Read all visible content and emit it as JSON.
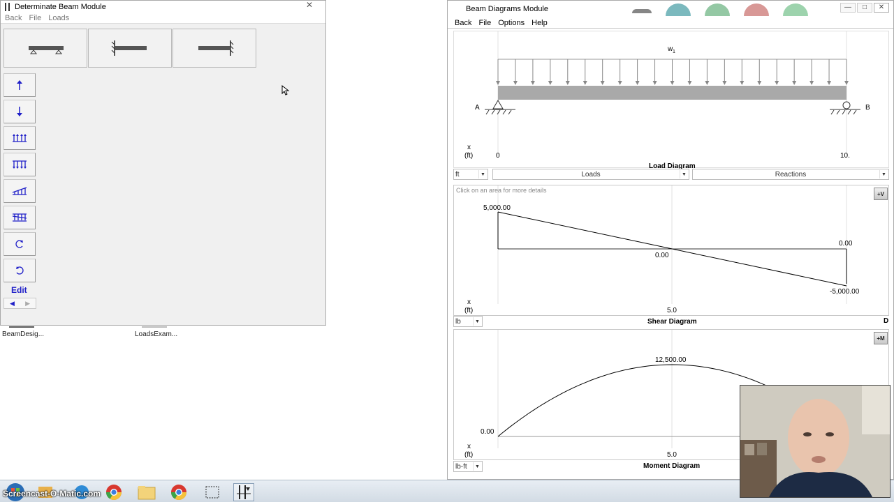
{
  "desktop": {
    "icons": [
      {
        "label": "BeamDesig..."
      },
      {
        "label": "LoadsExam..."
      }
    ]
  },
  "left_window": {
    "title": "Determinate Beam Module",
    "menu": [
      "Back",
      "File",
      "Loads"
    ],
    "support_buttons": [
      "simply-supported",
      "cantilever-left",
      "cantilever-right"
    ],
    "tools": [
      "point-load-up",
      "point-load-down",
      "uniform-load-up",
      "uniform-load-down",
      "varying-load-up",
      "varying-load-down",
      "moment-ccw",
      "moment-cw"
    ],
    "edit_label": "Edit"
  },
  "right_window": {
    "title": "Beam Diagrams Module",
    "menu": [
      "Back",
      "File",
      "Options",
      "Help"
    ],
    "load_diagram": {
      "load_label": "w",
      "load_subscript": "1",
      "support_a": "A",
      "support_b": "B",
      "x_label": "x",
      "x_unit": "(ft)",
      "x_start": "0",
      "x_end": "10.",
      "caption": "Load Diagram",
      "unit_select": "ft",
      "loads_select": "Loads",
      "reactions_select": "Reactions"
    },
    "shear_diagram": {
      "hint": "Click on an area for more details",
      "corner": "+V",
      "max_label": "5,000.00",
      "mid_label": "0.00",
      "end_label": "0.00",
      "min_label": "-5,000.00",
      "x_label": "x",
      "x_unit": "(ft)",
      "x_mid": "5.0",
      "caption": "Shear Diagram",
      "unit_select": "lb",
      "right_tag": "D"
    },
    "moment_diagram": {
      "corner": "+M",
      "max_label": "12,500.00",
      "start_label": "0.00",
      "x_label": "x",
      "x_unit": "(ft)",
      "x_mid": "5.0",
      "caption": "Moment Diagram",
      "unit_select": "lb-ft"
    }
  },
  "taskbar": {
    "watermark": "Screencast-O-Matic.com"
  },
  "chart_data": [
    {
      "type": "line",
      "title": "Shear Diagram",
      "xlabel": "x (ft)",
      "ylabel": "lb",
      "x": [
        0,
        5,
        10
      ],
      "values": [
        5000,
        0,
        -5000
      ]
    },
    {
      "type": "line",
      "title": "Moment Diagram",
      "xlabel": "x (ft)",
      "ylabel": "lb-ft",
      "x": [
        0,
        5,
        10
      ],
      "values": [
        0,
        12500,
        0
      ]
    }
  ]
}
